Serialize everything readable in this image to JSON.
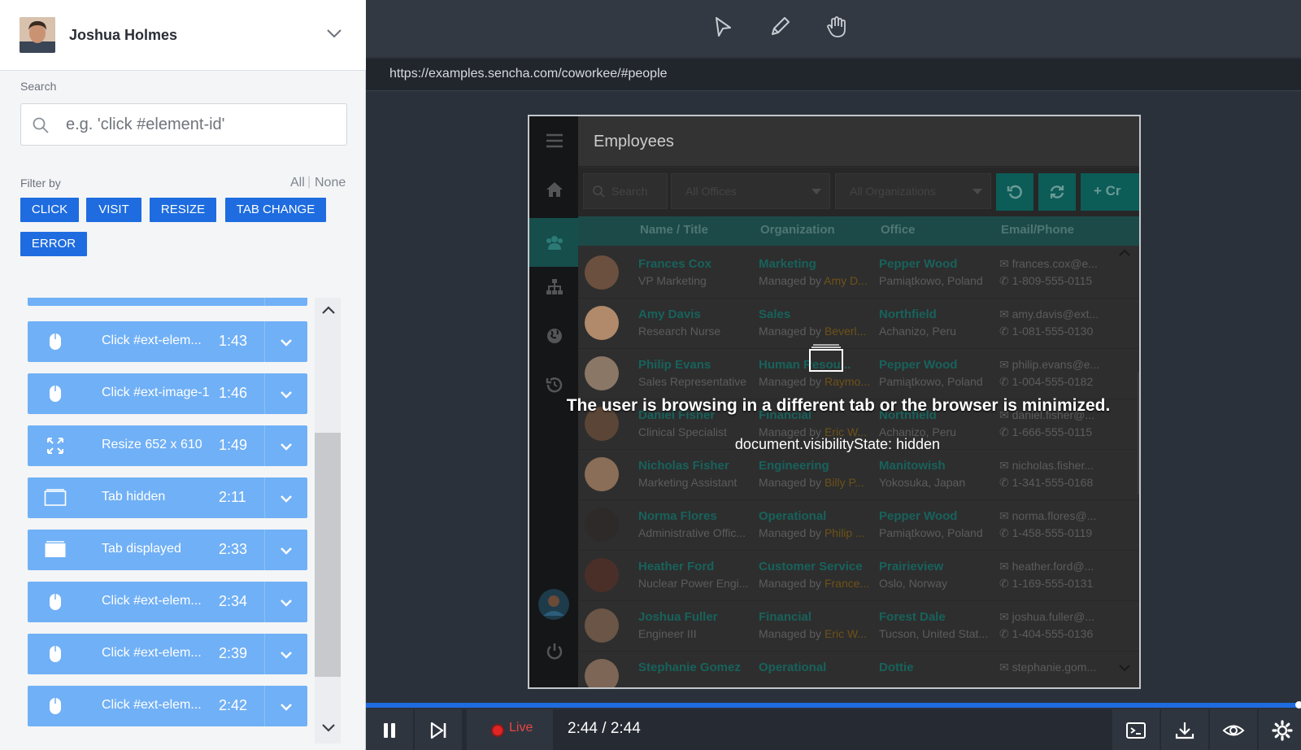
{
  "user": {
    "name": "Joshua Holmes"
  },
  "search": {
    "label": "Search",
    "placeholder": "e.g. 'click #element-id'"
  },
  "filter": {
    "label": "Filter by",
    "all": "All",
    "separator": "|",
    "none": "None",
    "buttons": [
      "CLICK",
      "VISIT",
      "RESIZE",
      "TAB CHANGE",
      "ERROR"
    ]
  },
  "events": [
    {
      "icon": "mouse-icon",
      "label": "Click #ext-elem...",
      "time": "1:43"
    },
    {
      "icon": "mouse-icon",
      "label": "Click #ext-image-1",
      "time": "1:46"
    },
    {
      "icon": "resize-icon",
      "label": "Resize 652 x 610",
      "time": "1:49"
    },
    {
      "icon": "tab-outline-icon",
      "label": "Tab hidden",
      "time": "2:11"
    },
    {
      "icon": "tab-filled-icon",
      "label": "Tab displayed",
      "time": "2:33"
    },
    {
      "icon": "mouse-icon",
      "label": "Click #ext-elem...",
      "time": "2:34"
    },
    {
      "icon": "mouse-icon",
      "label": "Click #ext-elem...",
      "time": "2:39"
    },
    {
      "icon": "mouse-icon",
      "label": "Click #ext-elem...",
      "time": "2:42"
    }
  ],
  "player": {
    "url": "https://examples.sencha.com/coworkee/#people",
    "live_label": "Live",
    "time": "2:44 / 2:44",
    "progress": 1.0
  },
  "app": {
    "title": "Employees",
    "search_placeholder": "Search",
    "offices_placeholder": "All Offices",
    "orgs_placeholder": "All Organizations",
    "create_label": "+ Cr",
    "columns": [
      "Name / Title",
      "Organization",
      "Office",
      "Email/Phone"
    ],
    "rows": [
      {
        "name": "Frances Cox",
        "title": "VP Marketing",
        "org": "Marketing",
        "mgr_prefix": "Managed by ",
        "mgr": "Amy D...",
        "office": "Pepper Wood",
        "location": "Pamiątkowo, Poland",
        "email": "frances.cox@e...",
        "phone": "1-809-555-0115"
      },
      {
        "name": "Amy Davis",
        "title": "Research Nurse",
        "org": "Sales",
        "mgr_prefix": "Managed by ",
        "mgr": "Beverl...",
        "office": "Northfield",
        "location": "Achanizo, Peru",
        "email": "amy.davis@ext...",
        "phone": "1-081-555-0130"
      },
      {
        "name": "Philip Evans",
        "title": "Sales Representative",
        "org": "Human Resou...",
        "mgr_prefix": "Managed by ",
        "mgr": "Raymo...",
        "office": "Pepper Wood",
        "location": "Pamiątkowo, Poland",
        "email": "philip.evans@e...",
        "phone": "1-004-555-0182"
      },
      {
        "name": "Daniel Fisher",
        "title": "Clinical Specialist",
        "org": "Financial",
        "mgr_prefix": "Managed by ",
        "mgr": "Eric W...",
        "office": "Northfield",
        "location": "Achanizo, Peru",
        "email": "daniel.fisher@...",
        "phone": "1-666-555-0115"
      },
      {
        "name": "Nicholas Fisher",
        "title": "Marketing Assistant",
        "org": "Engineering",
        "mgr_prefix": "Managed by ",
        "mgr": "Billy P...",
        "office": "Manitowish",
        "location": "Yokosuka, Japan",
        "email": "nicholas.fisher...",
        "phone": "1-341-555-0168"
      },
      {
        "name": "Norma Flores",
        "title": "Administrative Offic...",
        "org": "Operational",
        "mgr_prefix": "Managed by ",
        "mgr": "Philip ...",
        "office": "Pepper Wood",
        "location": "Pamiątkowo, Poland",
        "email": "norma.flores@...",
        "phone": "1-458-555-0119"
      },
      {
        "name": "Heather Ford",
        "title": "Nuclear Power Engi...",
        "org": "Customer Service",
        "mgr_prefix": "Managed by ",
        "mgr": "France...",
        "office": "Prairieview",
        "location": "Oslo, Norway",
        "email": "heather.ford@...",
        "phone": "1-169-555-0131"
      },
      {
        "name": "Joshua Fuller",
        "title": "Engineer III",
        "org": "Financial",
        "mgr_prefix": "Managed by ",
        "mgr": "Eric W...",
        "office": "Forest Dale",
        "location": "Tucson, United Stat...",
        "email": "joshua.fuller@...",
        "phone": "1-404-555-0136"
      },
      {
        "name": "Stephanie Gomez",
        "title": "",
        "org": "Operational",
        "mgr_prefix": "",
        "mgr": "",
        "office": "Dottie",
        "location": "",
        "email": "stephanie.gom...",
        "phone": ""
      }
    ]
  },
  "overlay": {
    "message": "The user is browsing in a different tab or the browser is minimized.",
    "state": "document.visibilityState: hidden"
  },
  "colors": {
    "accent": "#1e6ce0",
    "event_bg": "#70b0f6",
    "live": "#e02424",
    "app_teal": "#17625c"
  }
}
